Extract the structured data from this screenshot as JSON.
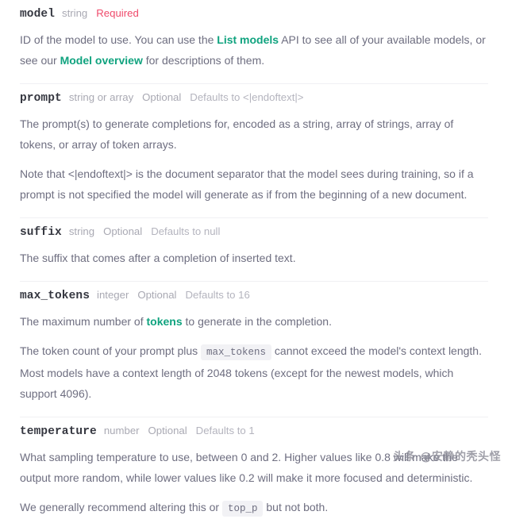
{
  "document": {
    "kind": "api-reference-parameters",
    "accent_link_color": "#10a37f",
    "required_color": "#ef4a6b",
    "body_text_color": "#6e6e80",
    "name_text_color": "#353740",
    "meta_text_color": "#a9a9b3",
    "divider_color": "#f0f0f3",
    "code_bg_color": "#f2f2f5"
  },
  "params": [
    {
      "name": "model",
      "type": "string",
      "requirement": "Required",
      "requirement_style": "required",
      "default": "",
      "paragraphs": [
        {
          "parts": [
            {
              "t": "text",
              "v": "ID of the model to use. You can use the "
            },
            {
              "t": "link",
              "v": "List models"
            },
            {
              "t": "text",
              "v": " API to see all of your available models, or see our "
            },
            {
              "t": "link",
              "v": "Model overview"
            },
            {
              "t": "text",
              "v": " for descriptions of them."
            }
          ]
        }
      ]
    },
    {
      "name": "prompt",
      "type": "string or array",
      "requirement": "Optional",
      "requirement_style": "optional",
      "default": "Defaults to <|endoftext|>",
      "paragraphs": [
        {
          "parts": [
            {
              "t": "text",
              "v": "The prompt(s) to generate completions for, encoded as a string, array of strings, array of tokens, or array of token arrays."
            }
          ]
        },
        {
          "parts": [
            {
              "t": "text",
              "v": "Note that <|endoftext|> is the document separator that the model sees during training, so if a prompt is not specified the model will generate as if from the beginning of a new document."
            }
          ]
        }
      ]
    },
    {
      "name": "suffix",
      "type": "string",
      "requirement": "Optional",
      "requirement_style": "optional",
      "default": "Defaults to null",
      "paragraphs": [
        {
          "parts": [
            {
              "t": "text",
              "v": "The suffix that comes after a completion of inserted text."
            }
          ]
        }
      ]
    },
    {
      "name": "max_tokens",
      "type": "integer",
      "requirement": "Optional",
      "requirement_style": "optional",
      "default": "Defaults to 16",
      "paragraphs": [
        {
          "parts": [
            {
              "t": "text",
              "v": "The maximum number of "
            },
            {
              "t": "link",
              "v": "tokens"
            },
            {
              "t": "text",
              "v": " to generate in the completion."
            }
          ]
        },
        {
          "parts": [
            {
              "t": "text",
              "v": "The token count of your prompt plus "
            },
            {
              "t": "code",
              "v": "max_tokens"
            },
            {
              "t": "text",
              "v": " cannot exceed the model's context length. Most models have a context length of 2048 tokens (except for the newest models, which support 4096)."
            }
          ]
        }
      ]
    },
    {
      "name": "temperature",
      "type": "number",
      "requirement": "Optional",
      "requirement_style": "optional",
      "default": "Defaults to 1",
      "paragraphs": [
        {
          "parts": [
            {
              "t": "text",
              "v": "What sampling temperature to use, between 0 and 2. Higher values like 0.8 will make the output more random, while lower values like 0.2 will make it more focused and deterministic."
            }
          ]
        },
        {
          "parts": [
            {
              "t": "text",
              "v": "We generally recommend altering this or "
            },
            {
              "t": "code",
              "v": "top_p"
            },
            {
              "t": "text",
              "v": " but not both."
            }
          ]
        }
      ]
    }
  ],
  "watermark": {
    "text": "头条 @安静的秃头怪"
  }
}
